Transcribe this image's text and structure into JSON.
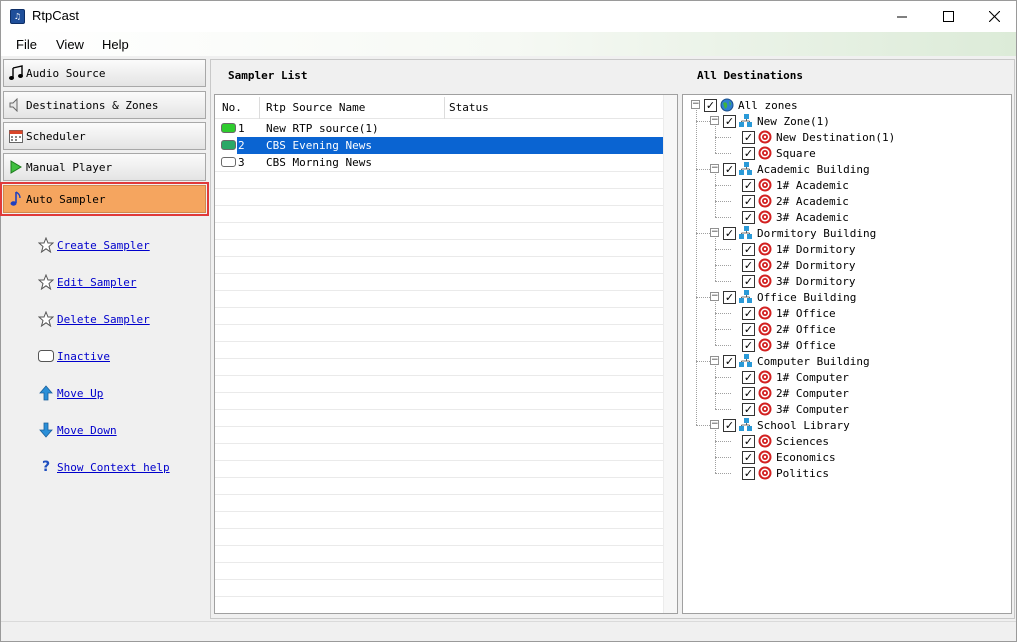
{
  "window": {
    "title": "RtpCast"
  },
  "menu": [
    "File",
    "View",
    "Help"
  ],
  "nav": [
    {
      "label": "Audio Source",
      "icon": "music-note-icon"
    },
    {
      "label": "Destinations & Zones",
      "icon": "speaker-icon"
    },
    {
      "label": "Scheduler",
      "icon": "calendar-icon"
    },
    {
      "label": "Manual Player",
      "icon": "play-icon"
    },
    {
      "label": "Auto Sampler",
      "icon": "music-note-blue-icon",
      "active": true
    }
  ],
  "actions": [
    {
      "label": "Create Sampler",
      "icon": "star-icon"
    },
    {
      "label": "Edit Sampler",
      "icon": "star-icon"
    },
    {
      "label": "Delete Sampler",
      "icon": "star-icon"
    },
    {
      "label": "Inactive",
      "icon": "inactive-icon"
    },
    {
      "label": "Move Up",
      "icon": "arrow-up-icon"
    },
    {
      "label": "Move Down",
      "icon": "arrow-down-icon"
    },
    {
      "label": "Show Context help",
      "icon": "question-icon"
    }
  ],
  "sampler_list": {
    "title": "Sampler List",
    "columns": [
      "No.",
      "Rtp Source Name",
      "Status"
    ],
    "rows": [
      {
        "no": "1",
        "name": "New RTP source(1)",
        "status": "",
        "indicator": "#2ecc2e"
      },
      {
        "no": "2",
        "name": "CBS Evening News",
        "status": "",
        "indicator": "#2aa866",
        "selected": true
      },
      {
        "no": "3",
        "name": "CBS Morning News",
        "status": "",
        "indicator": "#ffffff"
      }
    ]
  },
  "destinations": {
    "title": "All Destinations",
    "root": "All zones",
    "zones": [
      {
        "name": "New Zone(1)",
        "items": [
          "New Destination(1)",
          "Square"
        ]
      },
      {
        "name": "Academic Building",
        "items": [
          "1# Academic",
          "2# Academic",
          "3# Academic"
        ]
      },
      {
        "name": "Dormitory Building",
        "items": [
          "1# Dormitory",
          "2# Dormitory",
          "3# Dormitory"
        ]
      },
      {
        "name": "Office Building",
        "items": [
          "1# Office",
          "2# Office",
          "3# Office"
        ]
      },
      {
        "name": "Computer Building",
        "items": [
          "1# Computer",
          "2# Computer",
          "3# Computer"
        ]
      },
      {
        "name": "School Library",
        "items": [
          "Sciences",
          "Economics",
          "Politics"
        ]
      }
    ]
  },
  "colors": {
    "active_nav": "#f5a55f",
    "highlight_outline": "#e03a3a",
    "selection": "#0a64d2",
    "link": "#0000cc"
  }
}
